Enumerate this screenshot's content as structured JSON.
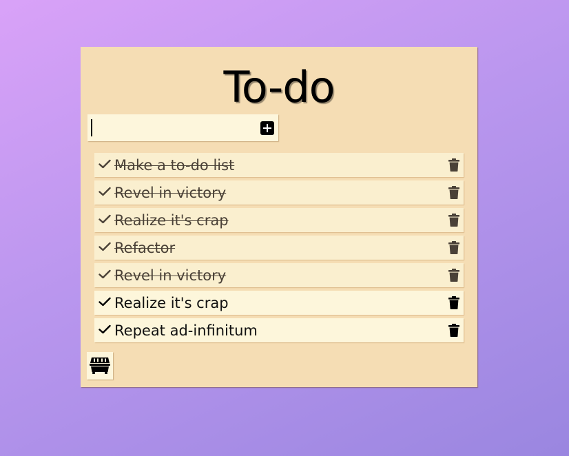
{
  "header": {
    "title": "To-do"
  },
  "new_item": {
    "value": "",
    "placeholder": "",
    "add_icon": "plus-square-icon"
  },
  "items": [
    {
      "text": "Make a to-do list",
      "completed": true
    },
    {
      "text": "Revel in victory",
      "completed": true
    },
    {
      "text": "Realize it's crap",
      "completed": true
    },
    {
      "text": "Refactor",
      "completed": true
    },
    {
      "text": "Revel in victory",
      "completed": true
    },
    {
      "text": "Realize it's crap",
      "completed": false
    },
    {
      "text": "Repeat ad-infinitum",
      "completed": false
    }
  ],
  "icons": {
    "check": "check-icon",
    "delete": "trash-icon",
    "clear_completed": "dumpster-icon"
  },
  "colors": {
    "background_start": "#d9a2f8",
    "background_end": "#9a86e0",
    "card": "#f5ddb4",
    "item_done": "#faefcf",
    "item_active": "#fdf6db",
    "done_text": "#4a4137",
    "active_text": "#111111"
  }
}
